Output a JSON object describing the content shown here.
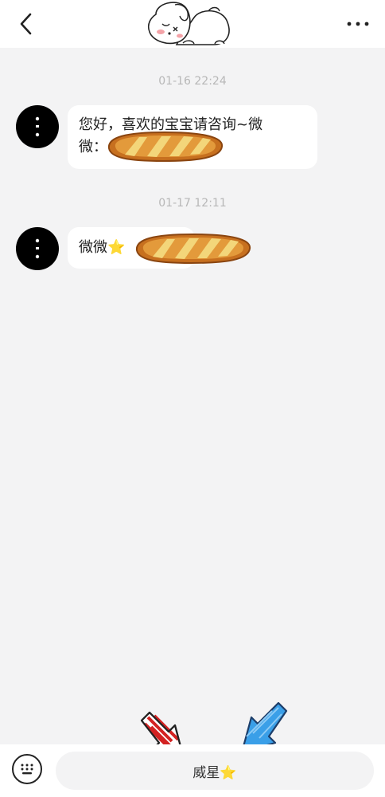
{
  "header": {
    "back_icon": "chevron-left-icon",
    "more_icon": "more-horizontal-icon",
    "avatar_icon": "sleeping-puppy-avatar"
  },
  "messages": [
    {
      "timestamp": "01-16 22:24",
      "text_line1": "您好，喜欢的宝宝请咨询~微",
      "text_line2": "微：",
      "redaction": "bread-sticker"
    },
    {
      "timestamp": "01-17 12:11",
      "text": "微微⭐️",
      "redaction": "bread-sticker"
    }
  ],
  "input": {
    "value": "威星⭐️",
    "keyboard_icon": "keyboard-icon"
  },
  "annotations": {
    "arrow_left_color": "#d32222",
    "arrow_right_color": "#3a9fe8"
  }
}
